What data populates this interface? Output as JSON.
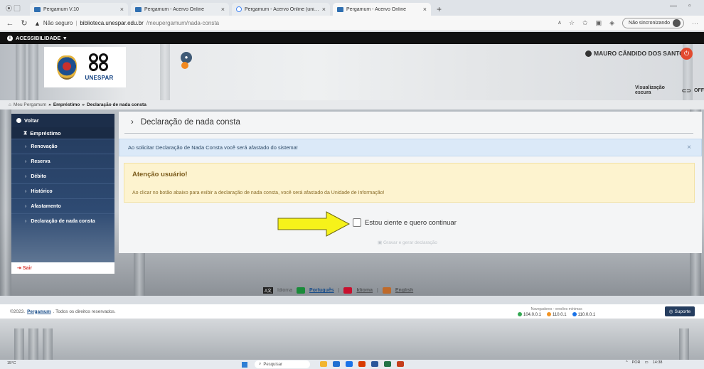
{
  "browser": {
    "tabs": [
      {
        "label": "Pergamum V.10",
        "active": false
      },
      {
        "label": "Pergamum - Acervo Online",
        "active": false
      },
      {
        "label": "Pergamum - Acervo Online (uni…",
        "active": false
      },
      {
        "label": "Pergamum - Acervo Online",
        "active": true
      }
    ],
    "security_label": "Não seguro",
    "url_host": "biblioteca.unespar.edu.br",
    "url_path": "/meupergamum/nada-consta",
    "sync_label": "Não sincronizando"
  },
  "accessibility_label": "ACESSIBILIDADE",
  "header": {
    "logo_text": "UNESPAR",
    "notification_count": "0",
    "user_name": "MAURO CÂNDIDO DOS SANTOS",
    "dark_mode_label": "Visualização escura",
    "dark_mode_state": "OFF"
  },
  "breadcrumb": {
    "root": "Meu Pergamum",
    "sep": "»",
    "level1": "Empréstimo",
    "level2": "Declaração de nada consta"
  },
  "sidebar": {
    "back_label": "Voltar",
    "section_label": "Empréstimo",
    "items": [
      {
        "label": "Renovação"
      },
      {
        "label": "Reserva"
      },
      {
        "label": "Débito"
      },
      {
        "label": "Histórico"
      },
      {
        "label": "Afastamento"
      },
      {
        "label": "Declaração de nada consta"
      }
    ],
    "exit_label": "Sair"
  },
  "content": {
    "title": "Declaração de nada consta",
    "info_alert": "Ao solicitar Declaração de Nada Consta você será afastado do sistema!",
    "warning_heading": "Atenção usuário!",
    "warning_text": "Ao clicar no botão abaixo para exibir a declaração de nada consta, você será afastado da Unidade de Informação!",
    "checkbox_label": "Estou ciente e quero continuar",
    "generate_button": "Gravar e gerar declaração"
  },
  "language_bar": {
    "label_a": "Idioma",
    "portuguese": "Português",
    "spanish": "Idioma",
    "english": "English"
  },
  "footer": {
    "copyright_prefix": "©2023.",
    "brand": "Pergamum",
    "copyright_suffix": ". Todos os direitos reservados.",
    "browsers_title": "Navegadores - versões mínimas",
    "chrome_version": "104.0.0.1",
    "firefox_version": "110.0.1",
    "edge_version": "110.0.0.1",
    "support_label": "Suporte"
  },
  "taskbar": {
    "weather": "15°C",
    "search_placeholder": "Pesquisar",
    "lang": "POR",
    "time": "14:38"
  },
  "colors": {
    "sidebar_bg": "#233a5c",
    "accent_red": "#e24a2f",
    "info_bg": "#dbe9f8",
    "warning_bg": "#fdf3cf",
    "arrow_yellow": "#f6f21a"
  }
}
